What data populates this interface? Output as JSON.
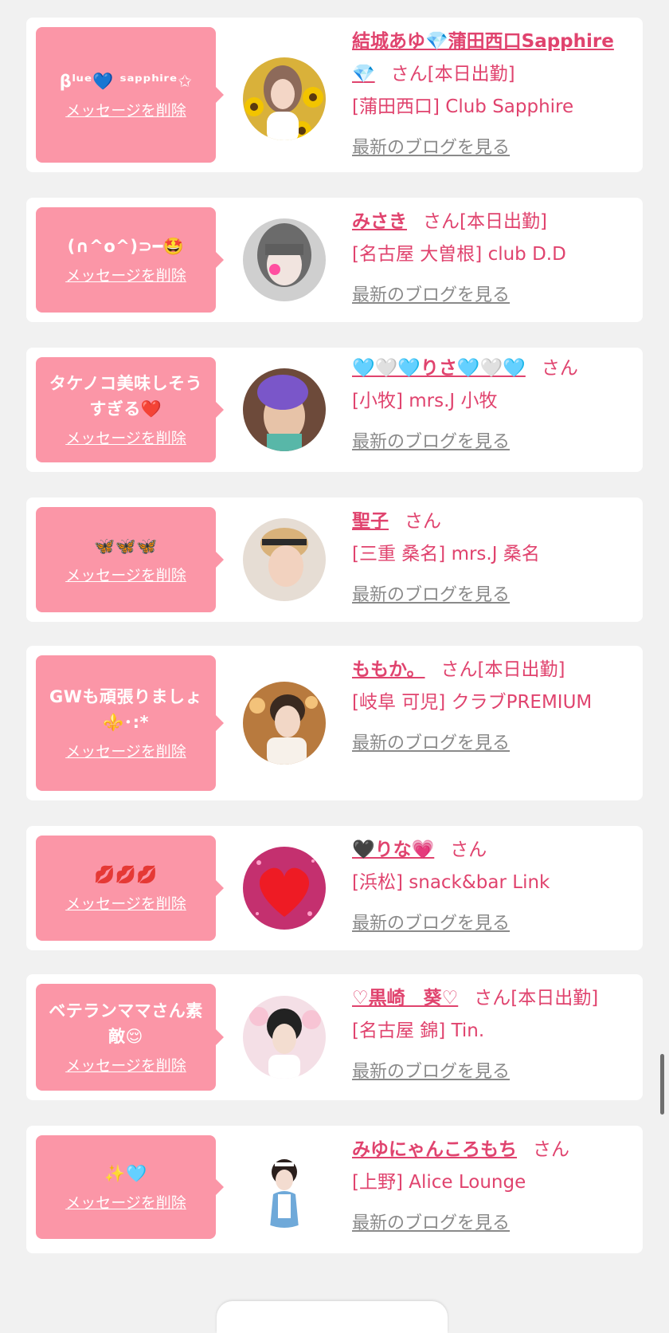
{
  "cards": [
    {
      "message": "βˡᵘᵉ💙 ˢᵃᵖᵖʰⁱʳᵉ✩",
      "delete_label": "メッセージを削除",
      "name": "結城あゆ💎蒲田西口Sapphire💎",
      "san": "さん",
      "status": "[本日出勤]",
      "shop": "[蒲田西口] Club Sapphire",
      "blog_label": "最新のブログを見る"
    },
    {
      "message": "(∩^o^)⊃━🤩",
      "delete_label": "メッセージを削除",
      "name": "みさき",
      "san": "さん",
      "status": "[本日出勤]",
      "shop": "[名古屋 大曽根] club D.D",
      "blog_label": "最新のブログを見る"
    },
    {
      "message": "タケノコ美味しそうすぎる❤️",
      "delete_label": "メッセージを削除",
      "name": "🩵🤍🩵りさ🩵🤍🩵",
      "san": "さん",
      "status": "",
      "shop": "[小牧] mrs.J 小牧",
      "blog_label": "最新のブログを見る"
    },
    {
      "message": "🦋🦋🦋",
      "delete_label": "メッセージを削除",
      "name": "聖子",
      "san": "さん",
      "status": "",
      "shop": "[三重 桑名] mrs.J 桑名",
      "blog_label": "最新のブログを見る"
    },
    {
      "message": "GWも頑張りましょ⚜️･:*",
      "delete_label": "メッセージを削除",
      "name": "ももか。",
      "san": "さん",
      "status": "[本日出勤]",
      "shop": "[岐阜 可児] クラブPREMIUM",
      "blog_label": "最新のブログを見る"
    },
    {
      "message": "💋💋💋",
      "delete_label": "メッセージを削除",
      "name": "🖤りな💗",
      "san": "さん",
      "status": "",
      "shop": "[浜松] snack&bar Link",
      "blog_label": "最新のブログを見る"
    },
    {
      "message": "ベテランママさん素敵😌",
      "delete_label": "メッセージを削除",
      "name": "♡黒崎　葵♡",
      "san": "さん",
      "status": "[本日出勤]",
      "shop": "[名古屋 錦] Tin.",
      "blog_label": "最新のブログを見る"
    },
    {
      "message": "✨🩵",
      "delete_label": "メッセージを削除",
      "name": "みゆにゃんころもち",
      "san": "さん",
      "status": "",
      "shop": "[上野] Alice Lounge",
      "blog_label": "最新のブログを見る"
    }
  ],
  "colors": {
    "page_bg": "#f1f1f1",
    "card_bg": "#ffffff",
    "bubble_bg": "#fb96a7",
    "accent_pink": "#e0436e",
    "link_gray": "#8a8a8a"
  }
}
